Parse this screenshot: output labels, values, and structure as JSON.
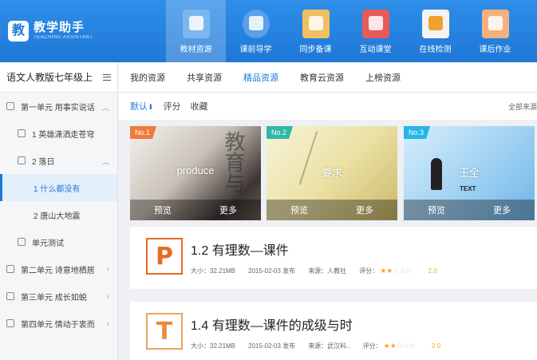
{
  "header": {
    "logo_mark": "教",
    "logo_title": "教学助手",
    "logo_sub": "TEACHING ASSISTANT",
    "nav": [
      {
        "label": "教材资源",
        "icon": "textbook-icon",
        "active": true
      },
      {
        "label": "课前导学",
        "icon": "compass-icon",
        "active": false
      },
      {
        "label": "同步备课",
        "icon": "envelope-icon",
        "active": false
      },
      {
        "label": "互动课堂",
        "icon": "whiteboard-icon",
        "active": false
      },
      {
        "label": "在线检测",
        "icon": "checklist-icon",
        "active": false
      },
      {
        "label": "课后作业",
        "icon": "homework-book-icon",
        "active": false
      }
    ]
  },
  "sidebar": {
    "grade": "语文人教版七年级上",
    "items": [
      {
        "label": "第一单元 用事实说话",
        "level": 1
      },
      {
        "label": "1 英雄潇洒走苍穹",
        "level": 2
      },
      {
        "label": "2 落日",
        "level": 2
      },
      {
        "label": "1 什么都没有",
        "level": 3
      },
      {
        "label": "2 唐山大地震",
        "level": 3
      },
      {
        "label": "单元测试",
        "level": 2
      },
      {
        "label": "第二单元 诗意地栖居",
        "level": 1
      },
      {
        "label": "第三单元 成长如蜕",
        "level": 1
      },
      {
        "label": "第四单元 情动于衷而",
        "level": 1
      }
    ]
  },
  "main": {
    "tabs": [
      "我的资源",
      "共享资源",
      "精品资源",
      "教育云资源",
      "上榜资源"
    ],
    "active_tab": "精品资源",
    "sort": {
      "default": "默认",
      "arrow": "⬇",
      "score": "评分",
      "favorite": "收藏",
      "all_sources": "全部来源"
    },
    "cards": [
      {
        "badge": "No.1",
        "caption": "produce",
        "deco": "教育与",
        "preview": "预览",
        "more": "更多"
      },
      {
        "badge": "No.2",
        "caption": "要求",
        "preview": "预览",
        "more": "更多"
      },
      {
        "badge": "No.3",
        "caption": "王全",
        "deco": "TEXT",
        "preview": "预览",
        "more": "更多"
      }
    ],
    "resources": [
      {
        "icon_letter": "P",
        "title": "1.2 有理数—课件",
        "size": "大小：32.21MB",
        "date": "2015-02-03 发布",
        "source": "来源：人教社",
        "rating_label": "评分：",
        "stars": 2,
        "score": "2.0"
      },
      {
        "icon_letter": "T",
        "title": "1.4 有理数—课件的成级与时",
        "size": "大小：32.21MB",
        "date": "2015-02-03 发布",
        "source": "来源：武汉料..",
        "rating_label": "评分：",
        "stars": 2,
        "score": "2.0"
      }
    ]
  },
  "colors": {
    "brand": "#1f78d6",
    "accent_orange": "#e86a1e",
    "star": "#f5a623"
  }
}
